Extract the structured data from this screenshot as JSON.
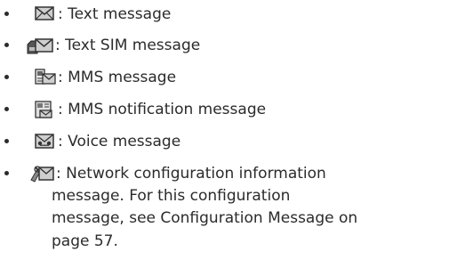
{
  "legend": {
    "items": [
      {
        "icon": "envelope-icon",
        "label": ": Text message"
      },
      {
        "icon": "sim-envelope-icon",
        "label": ": Text SIM message"
      },
      {
        "icon": "mms-icon",
        "label": ": MMS message"
      },
      {
        "icon": "mms-notification-icon",
        "label": ": MMS notification message"
      },
      {
        "icon": "voice-message-icon",
        "label": ": Voice message"
      },
      {
        "icon": "network-config-icon",
        "label": ": Network configuration information",
        "continuation": [
          "message. For this configuration",
          "message, see Configuration Message on",
          "page 57."
        ]
      }
    ]
  }
}
